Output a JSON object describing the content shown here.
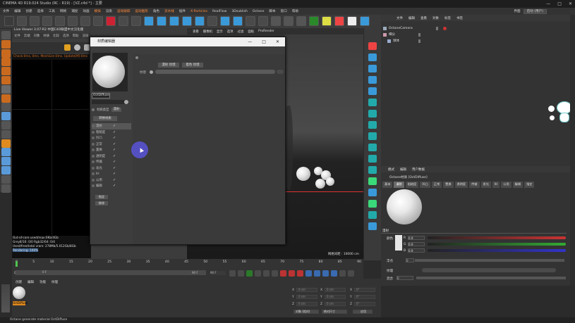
{
  "app": {
    "title": "CINEMA 4D R19.024 Studio (RC - R19) - [VZ.c4d *] - 主要",
    "window_controls": [
      "—",
      "□",
      "✕"
    ]
  },
  "menubar": {
    "items": [
      "文件",
      "编辑",
      "创建",
      "选择",
      "工具",
      "网格",
      "捕捉",
      "动画",
      "模拟",
      "渲染",
      "运动跟踪",
      "运动图形",
      "角色",
      "流水线",
      "插件",
      "X-Particles",
      "RealFlow",
      "3Dsublish",
      "Octane",
      "脚本",
      "窗口",
      "帮助"
    ],
    "accent_items": [
      8,
      10,
      11,
      13,
      15
    ],
    "layout_label": "界面",
    "layout_value": "启动 (用户)"
  },
  "live_viewer": {
    "title": "Live Viewer 3.07-R2 中国C4D联盟中文汉化版",
    "menu": [
      "文件",
      "云端",
      "对象",
      "材质",
      "比较",
      "选项",
      "帮助",
      "渲染"
    ],
    "status": "Check:0ms, 0ms. MeshGen:0ms. Update[M]:0ms",
    "stats": [
      "Out-of-core used/max:0Kb/4Gb",
      "Grey8/16: 0/0      Rgb32/64: 0/4",
      "Used/free/total vram: 278Mb/5.012Gb/8Gb",
      "Rendering: 100%  Ms/sec: 0   Time: 0:00 : 00 : 00 / 0:00   Spp/maxspp: 128/128   Tri: 0/0   Mesh: 5   Hair: 0"
    ],
    "stats_highlight": "Rendering: 100%"
  },
  "viewport": {
    "menu": [
      "查看",
      "摄像机",
      "显示",
      "选项",
      "过滤",
      "面板",
      "ProRender"
    ],
    "grid_label": "网格间距 : 10000 cm"
  },
  "material_editor": {
    "title": "材质编辑器",
    "material_name": "OctDiffuse",
    "channel_dropdown_label": "材质类型",
    "channel_dropdown_value": "漫射",
    "convert_button": "转换材质",
    "channels": [
      {
        "label": "漫射",
        "checked": true
      },
      {
        "label": "粗糙度",
        "checked": true
      },
      {
        "label": "凹凸",
        "checked": true
      },
      {
        "label": "正常",
        "checked": true
      },
      {
        "label": "置换",
        "checked": true
      },
      {
        "label": "透明度",
        "checked": true
      },
      {
        "label": "传输",
        "checked": true
      },
      {
        "label": "发光",
        "checked": true
      },
      {
        "label": "IH",
        "checked": true
      },
      {
        "label": "公用",
        "checked": true
      },
      {
        "label": "编辑",
        "checked": true
      }
    ],
    "bottom_buttons": [
      "指定",
      "移除"
    ],
    "right_buttons": [
      "漫射 纹理",
      "着色 纹理"
    ],
    "right_label": "纹理"
  },
  "object_manager": {
    "menu": [
      "文件",
      "编辑",
      "查看",
      "对象",
      "标签",
      "书签"
    ],
    "objects": [
      {
        "name": "OctaneCamera",
        "indent": 0
      },
      {
        "name": "细分",
        "indent": 0
      },
      {
        "name": "球体",
        "indent": 1
      }
    ]
  },
  "attribute_manager": {
    "menu": [
      "模式",
      "编辑",
      "用户数据"
    ],
    "material_label": "Octane材质 [OctDiffuse]",
    "tabs": [
      "基本",
      "漫射",
      "粗糙度",
      "凹凸",
      "正常",
      "置换",
      "透明度",
      "传输",
      "发光",
      "IH",
      "公用",
      "编辑",
      "指定"
    ],
    "active_tab": 1,
    "section": "漫射",
    "diffuse_label": "颜色",
    "rows": [
      {
        "label": "R",
        "value": "0.9"
      },
      {
        "label": "G",
        "value": "0.9"
      },
      {
        "label": "B",
        "value": "0.9"
      }
    ],
    "float_label": "浮点",
    "float_value": "0",
    "texture_label": "纹理",
    "mix_label": "混合",
    "mix_value": "0"
  },
  "timeline": {
    "ticks": [
      "0",
      "5",
      "10",
      "15",
      "20",
      "25",
      "30",
      "35",
      "40",
      "45",
      "50",
      "55",
      "60",
      "65",
      "70",
      "75",
      "80",
      "85",
      "90"
    ],
    "frame_start": "0 F",
    "frame_current": "0 F",
    "frame_end": "90 F",
    "frame_end2": "90 F"
  },
  "material_manager": {
    "menu": [
      "创建",
      "编辑",
      "功能",
      "纹理"
    ],
    "material_name": "OctDiffuse"
  },
  "coordinates": {
    "labels": [
      "X",
      "Y",
      "Z"
    ],
    "pos": "0 cm",
    "scale": "0 cm",
    "rot": "0°",
    "mode_dropdown": "对象 (相对)",
    "size_dropdown": "绝对尺寸",
    "apply_button": "应用"
  },
  "statusbar": {
    "text": "Octane generate material OctDiffuse"
  }
}
